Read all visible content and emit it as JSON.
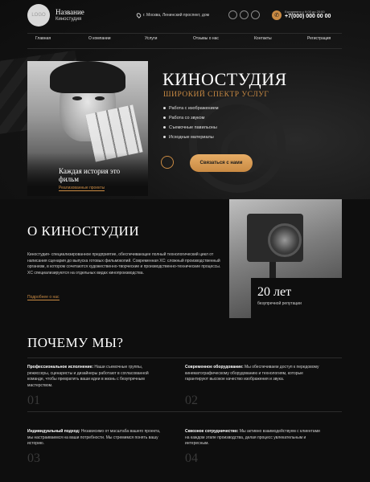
{
  "header": {
    "logo_text": "LOGO",
    "brand_name": "Название",
    "brand_sub": "Киностудия",
    "address": "г. Москва, Ленинский проспект, дом",
    "schedule": "Ежедневно с 9:00 до 20:00",
    "phone": "+7(000) 000 00 00"
  },
  "nav": [
    "Главная",
    "О компании",
    "Услуги",
    "Отзывы о нас",
    "Контакты",
    "Регистрация"
  ],
  "hero": {
    "title": "КИНОСТУДИЯ",
    "subtitle": "ШИРОКИЙ СПЕКТР УСЛУГ",
    "features": [
      "Работа с изображением",
      "Работа со звуком",
      "Съемочные павильоны",
      "Исходные материалы"
    ],
    "cta": "Связаться с нами",
    "caption": "Каждая история это фильм",
    "link": "Реализованные проекты"
  },
  "about": {
    "title": "О КИНОСТУДИИ",
    "text": "Киностудия- специализированное предприятие, обеспечивающее полный технологический цикл от написания сценария до выпуска готовых фильмокопий. Современная XC: сложный производственный организм, в котором сочетаются художественно-творческие и производственно-технические процессы. XC специализируются на отдельных видах кинопроизводства.",
    "link": "Подробнее о нас",
    "badge_num": "20 лет",
    "badge_text": "безупречной репутации"
  },
  "why": {
    "title": "ПОЧЕМУ МЫ?",
    "items": [
      {
        "title": "Профессиональное исполнение:",
        "text": "Наши съемочные группы, режиссеры, сценаристы и дизайнеры работают в согласованной команде, чтобы превратить ваши идеи в жизнь с безупречным мастерством.",
        "num": "01"
      },
      {
        "title": "Современное оборудование:",
        "text": "Мы обеспечиваем доступ к передовому кинематографическому оборудованию и технологиям, которые гарантируют высокое качество изображения и звука.",
        "num": "02"
      },
      {
        "title": "Индивидуальный подход:",
        "text": "Независимо от масштаба вашего проекта, мы настраиваемся на ваши потребности. Мы стремимся понять вашу историю.",
        "num": "03"
      },
      {
        "title": "Сквозное сотрудничество:",
        "text": "Мы активно взаимодействуем с клиентами на каждом этапе производства, делая процесс увлекательным и интересным.",
        "num": "04"
      }
    ]
  },
  "colors": {
    "accent": "#c98a43",
    "background": "#0e0e0e"
  }
}
